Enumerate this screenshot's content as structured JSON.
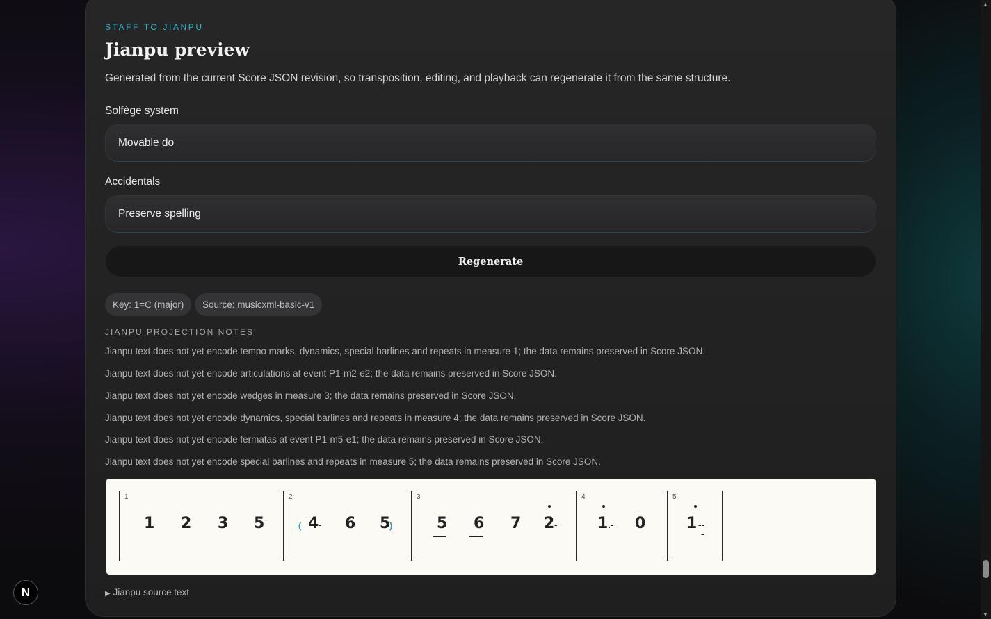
{
  "header": {
    "eyebrow": "STAFF TO JIANPU",
    "title": "Jianpu preview",
    "description": "Generated from the current Score JSON revision, so transposition, editing, and playback can regenerate it from the same structure."
  },
  "form": {
    "solfege_label": "Solfège system",
    "solfege_value": "Movable do",
    "accidentals_label": "Accidentals",
    "accidentals_value": "Preserve spelling",
    "regenerate_label": "Regenerate"
  },
  "pills": {
    "key": "Key: 1=C (major)",
    "source": "Source: musicxml-basic-v1"
  },
  "notes": {
    "title": "JIANPU PROJECTION NOTES",
    "items": [
      "Jianpu text does not yet encode tempo marks, dynamics, special barlines and repeats in measure 1; the data remains preserved in Score JSON.",
      "Jianpu text does not yet encode articulations at event P1-m2-e2; the data remains preserved in Score JSON.",
      "Jianpu text does not yet encode wedges in measure 3; the data remains preserved in Score JSON.",
      "Jianpu text does not yet encode dynamics, special barlines and repeats in measure 4; the data remains preserved in Score JSON.",
      "Jianpu text does not yet encode fermatas at event P1-m5-e1; the data remains preserved in Score JSON.",
      "Jianpu text does not yet encode special barlines and repeats in measure 5; the data remains preserved in Score JSON."
    ]
  },
  "score": {
    "measure_numbers": [
      "1",
      "2",
      "3",
      "4",
      "5"
    ],
    "m1": [
      "1",
      "2",
      "3",
      "5"
    ],
    "m2": [
      "4",
      "6",
      "5"
    ],
    "m3": [
      "5",
      "6",
      "7",
      "2"
    ],
    "m4": [
      "1",
      "0"
    ],
    "m5": [
      "1"
    ],
    "slur_open": "(",
    "slur_close": ")",
    "dash": "-",
    "dash_double": "--",
    "dot_dash": ".-"
  },
  "source_toggle": "Jianpu source text",
  "badge": "N"
}
